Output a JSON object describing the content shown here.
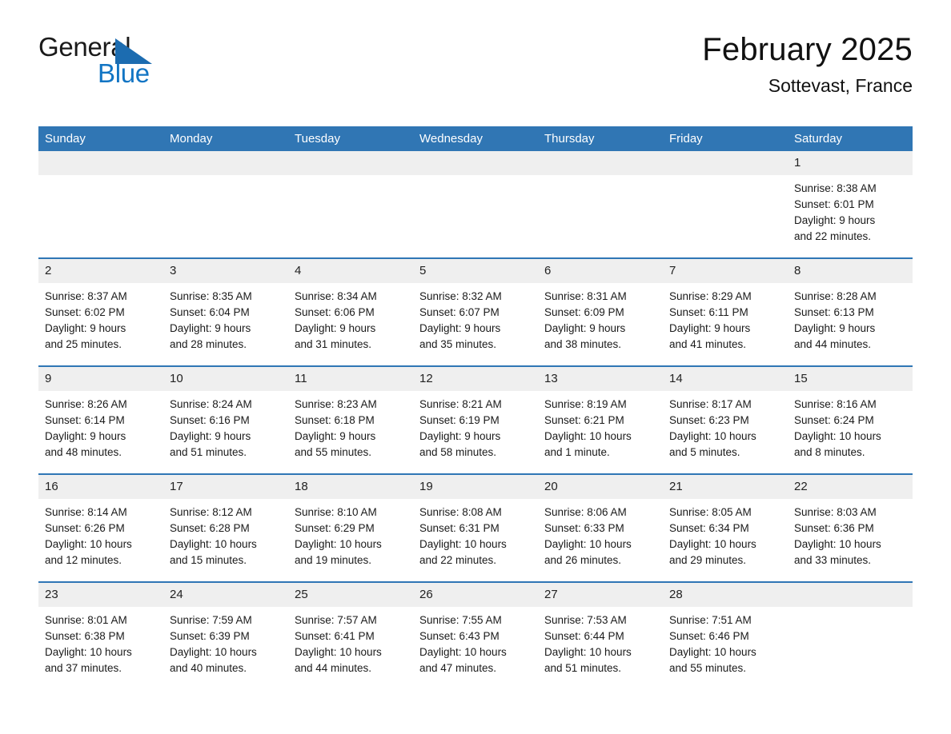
{
  "brand": {
    "name_part1": "General",
    "name_part2": "Blue",
    "triangle_icon": "blue-triangle-icon",
    "accent_color": "#1c6cb0",
    "blue_text_color": "#1275c4"
  },
  "header": {
    "title": "February 2025",
    "subtitle": "Sottevast, France"
  },
  "calendar": {
    "header_bg": "#3076b4",
    "daynum_bg": "#efefef",
    "row_divider_color": "#2f76b5",
    "weekday_headers": [
      "Sunday",
      "Monday",
      "Tuesday",
      "Wednesday",
      "Thursday",
      "Friday",
      "Saturday"
    ],
    "weeks": [
      [
        {
          "day": "",
          "empty": true
        },
        {
          "day": "",
          "empty": true
        },
        {
          "day": "",
          "empty": true
        },
        {
          "day": "",
          "empty": true
        },
        {
          "day": "",
          "empty": true
        },
        {
          "day": "",
          "empty": true
        },
        {
          "day": "1",
          "sunrise": "Sunrise: 8:38 AM",
          "sunset": "Sunset: 6:01 PM",
          "daylight_line1": "Daylight: 9 hours",
          "daylight_line2": "and 22 minutes."
        }
      ],
      [
        {
          "day": "2",
          "sunrise": "Sunrise: 8:37 AM",
          "sunset": "Sunset: 6:02 PM",
          "daylight_line1": "Daylight: 9 hours",
          "daylight_line2": "and 25 minutes."
        },
        {
          "day": "3",
          "sunrise": "Sunrise: 8:35 AM",
          "sunset": "Sunset: 6:04 PM",
          "daylight_line1": "Daylight: 9 hours",
          "daylight_line2": "and 28 minutes."
        },
        {
          "day": "4",
          "sunrise": "Sunrise: 8:34 AM",
          "sunset": "Sunset: 6:06 PM",
          "daylight_line1": "Daylight: 9 hours",
          "daylight_line2": "and 31 minutes."
        },
        {
          "day": "5",
          "sunrise": "Sunrise: 8:32 AM",
          "sunset": "Sunset: 6:07 PM",
          "daylight_line1": "Daylight: 9 hours",
          "daylight_line2": "and 35 minutes."
        },
        {
          "day": "6",
          "sunrise": "Sunrise: 8:31 AM",
          "sunset": "Sunset: 6:09 PM",
          "daylight_line1": "Daylight: 9 hours",
          "daylight_line2": "and 38 minutes."
        },
        {
          "day": "7",
          "sunrise": "Sunrise: 8:29 AM",
          "sunset": "Sunset: 6:11 PM",
          "daylight_line1": "Daylight: 9 hours",
          "daylight_line2": "and 41 minutes."
        },
        {
          "day": "8",
          "sunrise": "Sunrise: 8:28 AM",
          "sunset": "Sunset: 6:13 PM",
          "daylight_line1": "Daylight: 9 hours",
          "daylight_line2": "and 44 minutes."
        }
      ],
      [
        {
          "day": "9",
          "sunrise": "Sunrise: 8:26 AM",
          "sunset": "Sunset: 6:14 PM",
          "daylight_line1": "Daylight: 9 hours",
          "daylight_line2": "and 48 minutes."
        },
        {
          "day": "10",
          "sunrise": "Sunrise: 8:24 AM",
          "sunset": "Sunset: 6:16 PM",
          "daylight_line1": "Daylight: 9 hours",
          "daylight_line2": "and 51 minutes."
        },
        {
          "day": "11",
          "sunrise": "Sunrise: 8:23 AM",
          "sunset": "Sunset: 6:18 PM",
          "daylight_line1": "Daylight: 9 hours",
          "daylight_line2": "and 55 minutes."
        },
        {
          "day": "12",
          "sunrise": "Sunrise: 8:21 AM",
          "sunset": "Sunset: 6:19 PM",
          "daylight_line1": "Daylight: 9 hours",
          "daylight_line2": "and 58 minutes."
        },
        {
          "day": "13",
          "sunrise": "Sunrise: 8:19 AM",
          "sunset": "Sunset: 6:21 PM",
          "daylight_line1": "Daylight: 10 hours",
          "daylight_line2": "and 1 minute."
        },
        {
          "day": "14",
          "sunrise": "Sunrise: 8:17 AM",
          "sunset": "Sunset: 6:23 PM",
          "daylight_line1": "Daylight: 10 hours",
          "daylight_line2": "and 5 minutes."
        },
        {
          "day": "15",
          "sunrise": "Sunrise: 8:16 AM",
          "sunset": "Sunset: 6:24 PM",
          "daylight_line1": "Daylight: 10 hours",
          "daylight_line2": "and 8 minutes."
        }
      ],
      [
        {
          "day": "16",
          "sunrise": "Sunrise: 8:14 AM",
          "sunset": "Sunset: 6:26 PM",
          "daylight_line1": "Daylight: 10 hours",
          "daylight_line2": "and 12 minutes."
        },
        {
          "day": "17",
          "sunrise": "Sunrise: 8:12 AM",
          "sunset": "Sunset: 6:28 PM",
          "daylight_line1": "Daylight: 10 hours",
          "daylight_line2": "and 15 minutes."
        },
        {
          "day": "18",
          "sunrise": "Sunrise: 8:10 AM",
          "sunset": "Sunset: 6:29 PM",
          "daylight_line1": "Daylight: 10 hours",
          "daylight_line2": "and 19 minutes."
        },
        {
          "day": "19",
          "sunrise": "Sunrise: 8:08 AM",
          "sunset": "Sunset: 6:31 PM",
          "daylight_line1": "Daylight: 10 hours",
          "daylight_line2": "and 22 minutes."
        },
        {
          "day": "20",
          "sunrise": "Sunrise: 8:06 AM",
          "sunset": "Sunset: 6:33 PM",
          "daylight_line1": "Daylight: 10 hours",
          "daylight_line2": "and 26 minutes."
        },
        {
          "day": "21",
          "sunrise": "Sunrise: 8:05 AM",
          "sunset": "Sunset: 6:34 PM",
          "daylight_line1": "Daylight: 10 hours",
          "daylight_line2": "and 29 minutes."
        },
        {
          "day": "22",
          "sunrise": "Sunrise: 8:03 AM",
          "sunset": "Sunset: 6:36 PM",
          "daylight_line1": "Daylight: 10 hours",
          "daylight_line2": "and 33 minutes."
        }
      ],
      [
        {
          "day": "23",
          "sunrise": "Sunrise: 8:01 AM",
          "sunset": "Sunset: 6:38 PM",
          "daylight_line1": "Daylight: 10 hours",
          "daylight_line2": "and 37 minutes."
        },
        {
          "day": "24",
          "sunrise": "Sunrise: 7:59 AM",
          "sunset": "Sunset: 6:39 PM",
          "daylight_line1": "Daylight: 10 hours",
          "daylight_line2": "and 40 minutes."
        },
        {
          "day": "25",
          "sunrise": "Sunrise: 7:57 AM",
          "sunset": "Sunset: 6:41 PM",
          "daylight_line1": "Daylight: 10 hours",
          "daylight_line2": "and 44 minutes."
        },
        {
          "day": "26",
          "sunrise": "Sunrise: 7:55 AM",
          "sunset": "Sunset: 6:43 PM",
          "daylight_line1": "Daylight: 10 hours",
          "daylight_line2": "and 47 minutes."
        },
        {
          "day": "27",
          "sunrise": "Sunrise: 7:53 AM",
          "sunset": "Sunset: 6:44 PM",
          "daylight_line1": "Daylight: 10 hours",
          "daylight_line2": "and 51 minutes."
        },
        {
          "day": "28",
          "sunrise": "Sunrise: 7:51 AM",
          "sunset": "Sunset: 6:46 PM",
          "daylight_line1": "Daylight: 10 hours",
          "daylight_line2": "and 55 minutes."
        },
        {
          "day": "",
          "empty": true
        }
      ]
    ]
  }
}
